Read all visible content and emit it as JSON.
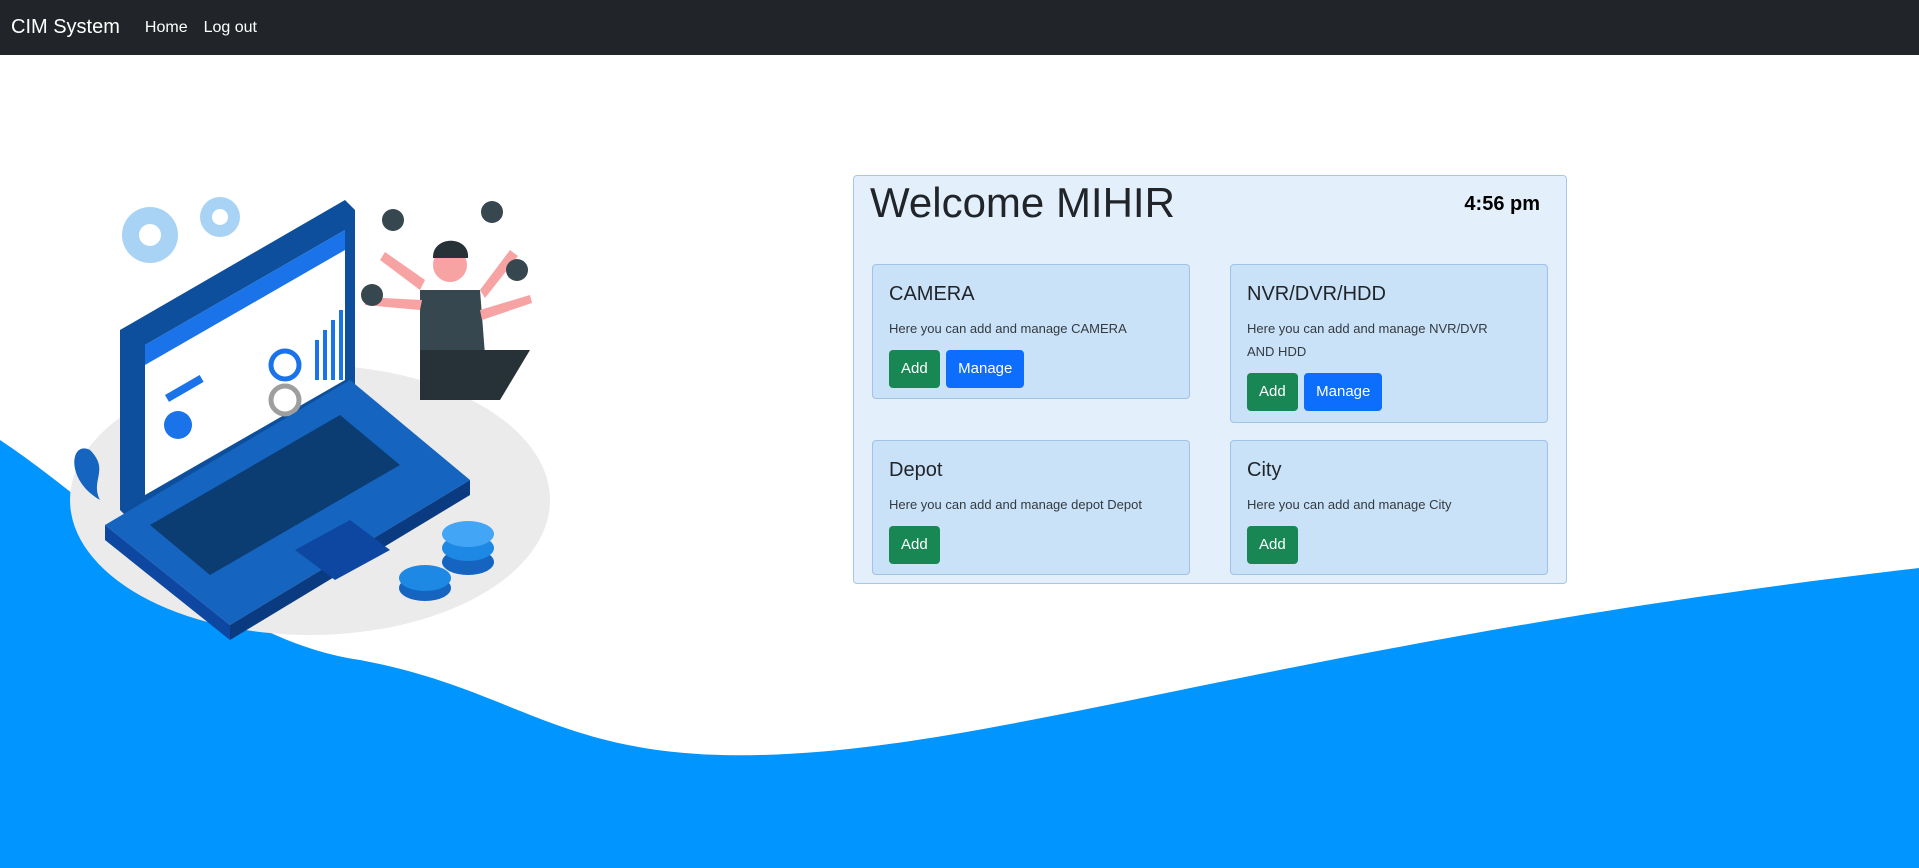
{
  "navbar": {
    "brand": "CIM System",
    "links": [
      "Home",
      "Log out"
    ],
    "background": "#212529"
  },
  "panel": {
    "welcome": "Welcome MIHIR",
    "time": "4:56 pm",
    "cards": [
      {
        "title": "CAMERA",
        "text": "Here you can add and manage CAMERA",
        "buttons": [
          "Add",
          "Manage"
        ]
      },
      {
        "title": "NVR/DVR/HDD",
        "text": "Here you can add and manage NVR/DVR AND HDD",
        "buttons": [
          "Add",
          "Manage"
        ]
      },
      {
        "title": "Depot",
        "text": "Here you can add and manage depot Depot",
        "buttons": [
          "Add"
        ]
      },
      {
        "title": "City",
        "text": "Here you can add and manage City",
        "buttons": [
          "Add"
        ]
      }
    ]
  },
  "colors": {
    "wave": "#0095ff",
    "add_button": "#198754",
    "manage_button": "#0d6efd",
    "panel_bg": "#e3f0fc",
    "card_bg": "#c9e2f8"
  },
  "illustration": {
    "icon": "admin-multitask-laptop-illustration"
  }
}
